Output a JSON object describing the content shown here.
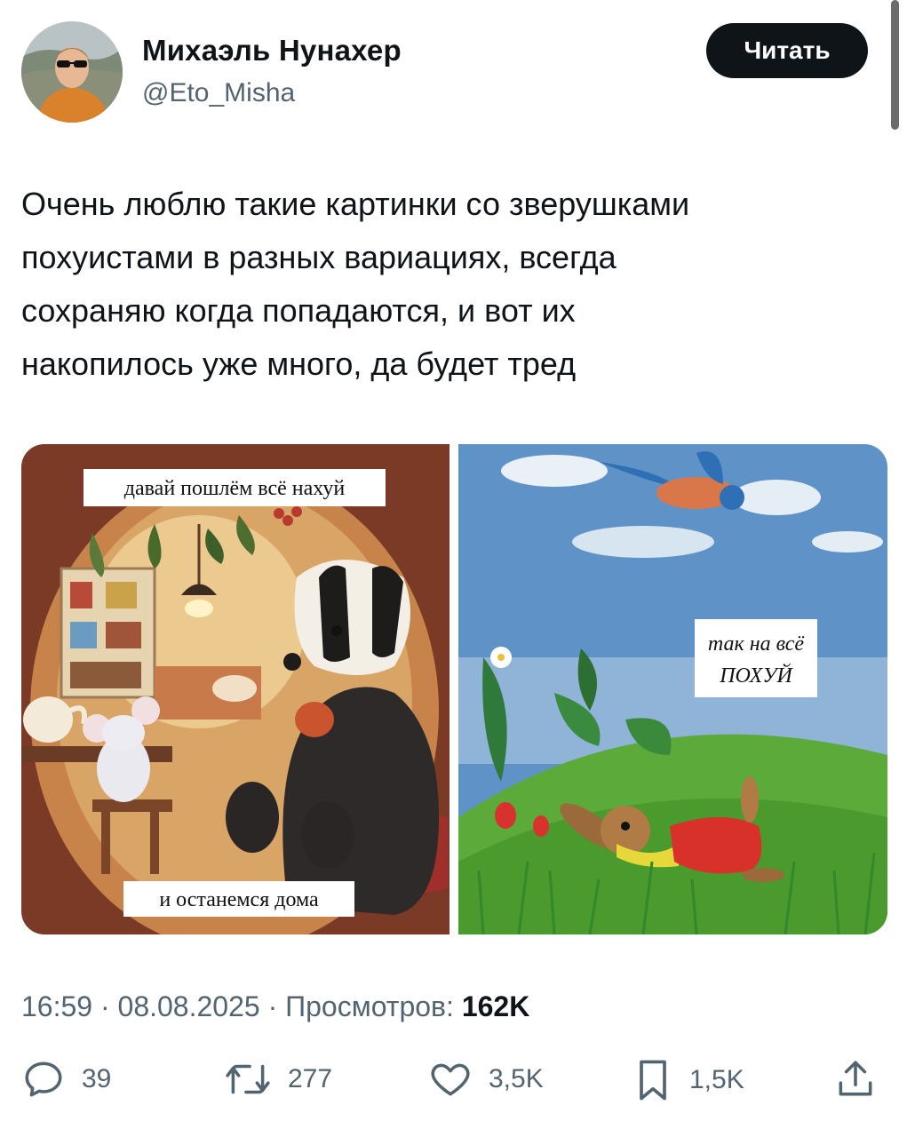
{
  "author": {
    "name": "Михаэль Нунахер",
    "handle": "@Eto_Misha"
  },
  "follow_button": "Читать",
  "tweet": {
    "text": "Очень люблю такие картинки со зверушками\nпохуистами в разных вариациях, всегда\nсохраняю когда попадаются, и вот их\nнакопилось уже много, да будет тред"
  },
  "media": {
    "left_caption_top": "давай пошлём всё нахуй",
    "left_caption_bottom": "и останемся дома",
    "right_caption_line1": "так на всё",
    "right_caption_line2": "ПОХУЙ"
  },
  "meta": {
    "time": "16:59",
    "separator": "·",
    "date": "08.08.2025",
    "views_label": "Просмотров:",
    "views_value": "162K"
  },
  "actions": {
    "replies": "39",
    "reposts": "277",
    "likes": "3,5K",
    "bookmarks": "1,5K"
  },
  "icons": [
    "reply-icon",
    "repost-icon",
    "like-icon",
    "bookmark-icon",
    "share-icon"
  ],
  "colors": {
    "text": "#0f1419",
    "secondary": "#536471",
    "button": "#0f1419"
  }
}
